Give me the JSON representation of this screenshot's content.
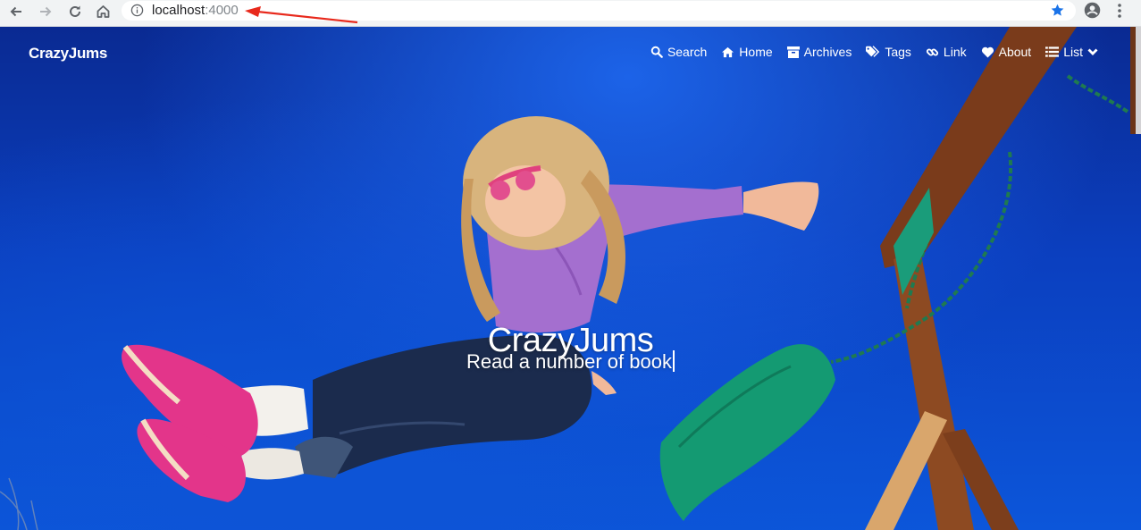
{
  "browser": {
    "url_host": "localhost",
    "url_port": ":4000",
    "icons": {
      "back": "back-arrow-icon",
      "forward": "forward-arrow-icon",
      "reload": "reload-icon",
      "home": "home-icon",
      "info": "info-icon",
      "bookmark": "star-icon",
      "account": "account-icon",
      "menu": "kebab-menu-icon"
    },
    "colors": {
      "chrome": "#f1f3f4",
      "star": "#1a73e8",
      "annotation": "#e8291c"
    }
  },
  "site": {
    "brand": "CrazyJums",
    "nav": [
      {
        "label": "Search",
        "icon": "search-icon"
      },
      {
        "label": "Home",
        "icon": "home-icon"
      },
      {
        "label": "Archives",
        "icon": "archive-icon"
      },
      {
        "label": "Tags",
        "icon": "tags-icon"
      },
      {
        "label": "Link",
        "icon": "link-icon"
      },
      {
        "label": "About",
        "icon": "heart-icon"
      },
      {
        "label": "List",
        "icon": "list-icon"
      }
    ],
    "hero_title": "CrazyJums",
    "hero_subtitle": "Read a number of book",
    "colors": {
      "sky": "#0b3fbf",
      "text": "#ffffff"
    }
  }
}
